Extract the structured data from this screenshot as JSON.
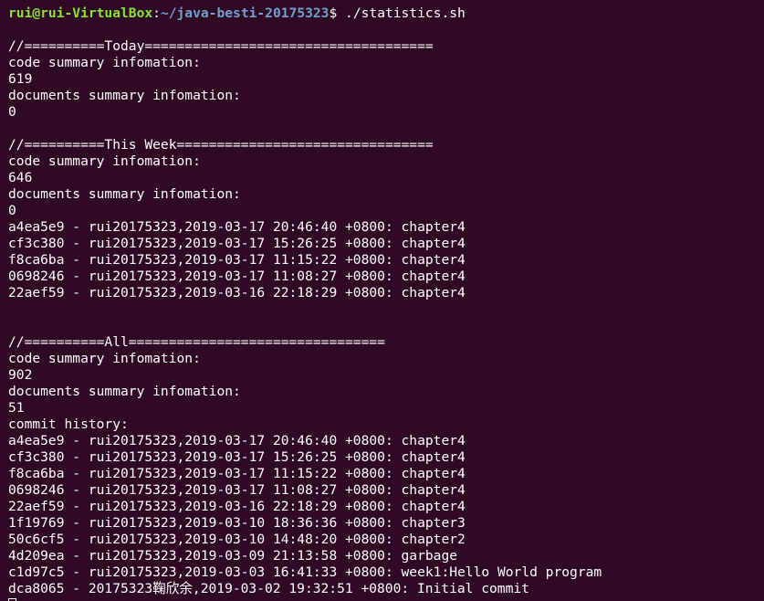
{
  "colors": {
    "background": "#300a24",
    "text": "#ffffff",
    "prompt_user": "#8ae234",
    "prompt_path": "#729fcf"
  },
  "prompt": {
    "user_host": "rui@rui-VirtualBox",
    "separator": ":",
    "path": "~/java-besti-20175323",
    "symbol": "$ ",
    "command": "./statistics.sh"
  },
  "output": [
    "",
    "//==========Today====================================",
    "code summary infomation:",
    "619",
    "documents summary infomation:",
    "0",
    "",
    "//==========This Week================================",
    "code summary infomation:",
    "646",
    "documents summary infomation:",
    "0",
    "a4ea5e9 - rui20175323,2019-03-17 20:46:40 +0800: chapter4",
    "cf3c380 - rui20175323,2019-03-17 15:26:25 +0800: chapter4",
    "f8ca6ba - rui20175323,2019-03-17 11:15:22 +0800: chapter4",
    "0698246 - rui20175323,2019-03-17 11:08:27 +0800: chapter4",
    "22aef59 - rui20175323,2019-03-16 22:18:29 +0800: chapter4",
    "",
    "",
    "//==========All================================",
    "code summary infomation:",
    "902",
    "documents summary infomation:",
    "51",
    "commit history:",
    "a4ea5e9 - rui20175323,2019-03-17 20:46:40 +0800: chapter4",
    "cf3c380 - rui20175323,2019-03-17 15:26:25 +0800: chapter4",
    "f8ca6ba - rui20175323,2019-03-17 11:15:22 +0800: chapter4",
    "0698246 - rui20175323,2019-03-17 11:08:27 +0800: chapter4",
    "22aef59 - rui20175323,2019-03-16 22:18:29 +0800: chapter4",
    "1f19769 - rui20175323,2019-03-10 18:36:36 +0800: chapter3",
    "50c6cf5 - rui20175323,2019-03-10 14:48:20 +0800: chapter2",
    "4d209ea - rui20175323,2019-03-09 21:13:58 +0800: garbage",
    "c1d97c5 - rui20175323,2019-03-03 16:41:33 +0800: week1:Hello World program",
    "dca8065 - 20175323鞠欣余,2019-03-02 19:32:51 +0800: Initial commit"
  ]
}
